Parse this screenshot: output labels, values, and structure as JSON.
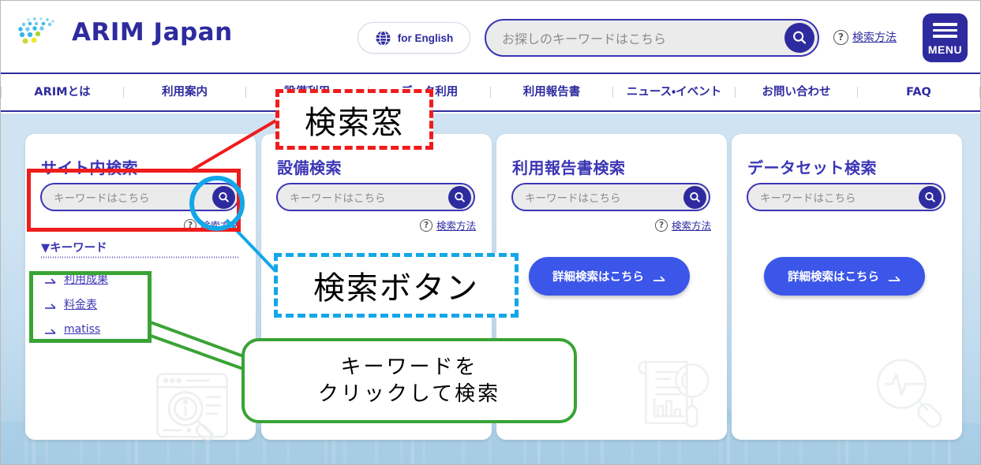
{
  "header": {
    "logo_text": "ARIM Japan",
    "logo_icon": "arim-dot-globe-logo",
    "english_button": {
      "label": "for English",
      "icon": "globe-icon"
    },
    "search": {
      "placeholder": "お探しのキーワードはこちら",
      "value": "",
      "button_icon": "search-icon"
    },
    "help": {
      "icon": "question-circle-icon",
      "label": "検索方法"
    },
    "menu": {
      "label": "MENU",
      "icon": "hamburger-icon"
    }
  },
  "nav": {
    "items": [
      {
        "label": "ARIMとは"
      },
      {
        "label": "利用案内"
      },
      {
        "label": "設備利用"
      },
      {
        "label": "データ利用"
      },
      {
        "label": "利用報告書"
      },
      {
        "label": "ニュース・イベント"
      },
      {
        "label": "お問い合わせ"
      },
      {
        "label": "FAQ"
      }
    ]
  },
  "cards": [
    {
      "title": "サイト内検索",
      "search_placeholder": "キーワードはこちら",
      "search_value": "",
      "help_label": "検索方法",
      "keywords_heading": "▼キーワード",
      "keywords": [
        {
          "label": "利用成果"
        },
        {
          "label": "料金表"
        },
        {
          "label": "matiss"
        }
      ],
      "watermark_icon": "browser-info-magnifier-icon"
    },
    {
      "title": "設備検索",
      "search_placeholder": "キーワードはこちら",
      "search_value": "",
      "help_label": "検索方法",
      "watermark_icon": "microscope-magnifier-icon"
    },
    {
      "title": "利用報告書検索",
      "search_placeholder": "キーワードはこちら",
      "search_value": "",
      "help_label": "検索方法",
      "detail_button": {
        "label": "詳細検索はこちら",
        "icon": "arrow-right-icon"
      },
      "watermark_icon": "report-magnifier-icon"
    },
    {
      "title": "データセット検索",
      "search_placeholder": "キーワードはこちら",
      "search_value": "",
      "help_label": "検索方法",
      "detail_button": {
        "label": "詳細検索はこちら",
        "icon": "arrow-right-icon"
      },
      "watermark_icon": "pulse-magnifier-icon"
    }
  ],
  "annotations": {
    "search_box_callout": "検索窓",
    "search_button_callout": "検索ボタン",
    "keyword_callout_line1": "キーワードを",
    "keyword_callout_line2": "クリックして検索"
  },
  "colors": {
    "brand_indigo": "#2e2b9f",
    "brand_blue": "#3b35b5",
    "button_blue": "#3b56e8",
    "annotation_red": "#ef1c1c",
    "annotation_cyan": "#13a7e8",
    "annotation_green": "#3aa335",
    "hero_bg_top": "#cfe3f2",
    "hero_bg_bottom": "#aed0e6",
    "input_bg": "#ebebeb"
  }
}
